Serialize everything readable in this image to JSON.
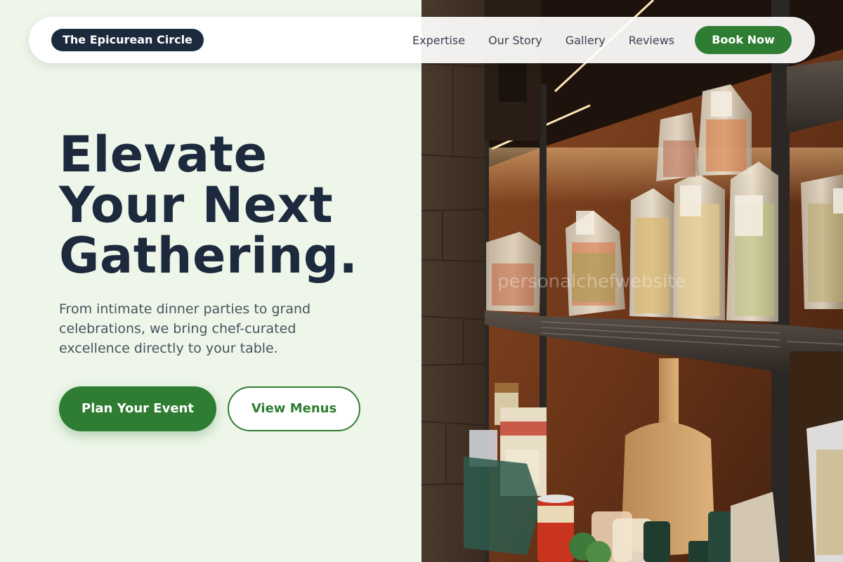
{
  "nav": {
    "brand": "The Epicurean Circle",
    "links": [
      "Expertise",
      "Our Story",
      "Gallery",
      "Reviews"
    ],
    "cta": "Book Now"
  },
  "hero": {
    "title_lines": [
      "Elevate",
      "Your Next",
      "Gathering."
    ],
    "subtitle": "From intimate dinner parties to grand celebrations, we bring chef-curated excellence directly to your table.",
    "primary_button": "Plan Your Event",
    "secondary_button": "View Menus"
  },
  "image": {
    "subject": "pantry-shelves-with-pasta",
    "watermark": "personalchefwebsite"
  },
  "colors": {
    "background": "#eef6e9",
    "navy": "#1d2a3e",
    "accent_green": "#2e7d32",
    "body_text": "#4a5260",
    "nav_text": "#3a4150"
  }
}
